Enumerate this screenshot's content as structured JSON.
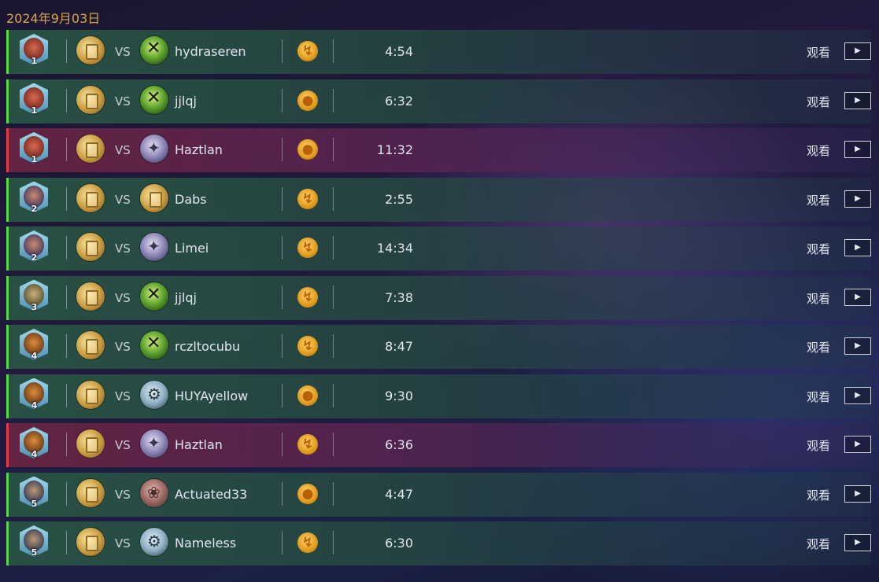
{
  "header": {
    "date": "2024年9月03日"
  },
  "labels": {
    "vs": "VS",
    "watch": "观看"
  },
  "icons": {
    "first_player": "lightning-swirl-icon",
    "second_player": "coin-icon",
    "play": "play-icon"
  },
  "colors": {
    "win": "#59d84b",
    "loss": "#e23a46",
    "date": "#d9a44a"
  },
  "matches": [
    {
      "rank": "1",
      "result": "win",
      "opponent": "hydraseren",
      "opponent_deck": "tinker",
      "turn": "first",
      "duration": "4:54"
    },
    {
      "rank": "1",
      "result": "win",
      "opponent": "jjlqj",
      "opponent_deck": "tinker",
      "turn": "second",
      "duration": "6:32"
    },
    {
      "rank": "1",
      "result": "loss",
      "opponent": "Haztlan",
      "opponent_deck": "wizard",
      "turn": "second",
      "duration": "11:32"
    },
    {
      "rank": "2",
      "result": "win",
      "opponent": "Dabs",
      "opponent_deck": "golden",
      "turn": "first",
      "duration": "2:55"
    },
    {
      "rank": "2",
      "result": "win",
      "opponent": "Limei",
      "opponent_deck": "wizard",
      "turn": "first",
      "duration": "14:34"
    },
    {
      "rank": "3",
      "result": "win",
      "opponent": "jjlqj",
      "opponent_deck": "tinker",
      "turn": "first",
      "duration": "7:38"
    },
    {
      "rank": "4",
      "result": "win",
      "opponent": "rczltocubu",
      "opponent_deck": "tinker",
      "turn": "first",
      "duration": "8:47"
    },
    {
      "rank": "4",
      "result": "win",
      "opponent": "HUYAyellow",
      "opponent_deck": "mech",
      "turn": "second",
      "duration": "9:30"
    },
    {
      "rank": "4",
      "result": "loss",
      "opponent": "Haztlan",
      "opponent_deck": "wizard",
      "turn": "first",
      "duration": "6:36"
    },
    {
      "rank": "5",
      "result": "win",
      "opponent": "Actuated33",
      "opponent_deck": "beast",
      "turn": "second",
      "duration": "4:47"
    },
    {
      "rank": "5",
      "result": "win",
      "opponent": "Nameless",
      "opponent_deck": "mech",
      "turn": "first",
      "duration": "6:30"
    }
  ]
}
